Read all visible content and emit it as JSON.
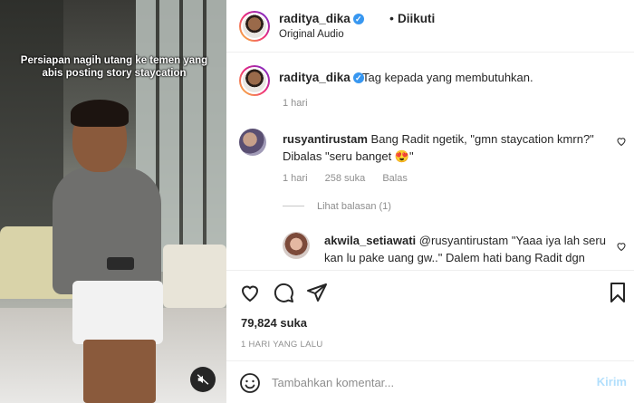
{
  "video": {
    "caption": "Persiapan nagih utang ke temen yang abis posting story staycation",
    "mute_icon": "speaker-muted-icon"
  },
  "header": {
    "username": "raditya_dika",
    "separator": "•",
    "follow_status": "Diikuti",
    "audio": "Original Audio",
    "more_icon": "more-options-icon"
  },
  "post_caption": {
    "username": "raditya_dika",
    "text": "Tag kepada yang membutuhkan.",
    "time": "1 hari"
  },
  "comments": [
    {
      "username": "rusyantirustam",
      "text": "Bang Radit ngetik, \"gmn staycation kmrn?\" Dibalas \"seru banget 😍\"",
      "time": "1 hari",
      "likes": "258 suka",
      "reply": "Balas",
      "view_replies": "Lihat balasan (1)"
    },
    {
      "username": "akwila_setiawati",
      "text": "@rusyantirustam \"Yaaa iya lah seru kan lu pake uang gw..\" Dalem hati bang Radit dgn"
    }
  ],
  "actions": {
    "likes": "79,824 suka",
    "time_ago": "1 HARI YANG LALU"
  },
  "add_comment": {
    "placeholder": "Tambahkan komentar...",
    "post_label": "Kirim"
  },
  "colors": {
    "verified": "#3897f0",
    "muted_text": "#8e8e8e",
    "post_disabled": "#b2dffc"
  }
}
